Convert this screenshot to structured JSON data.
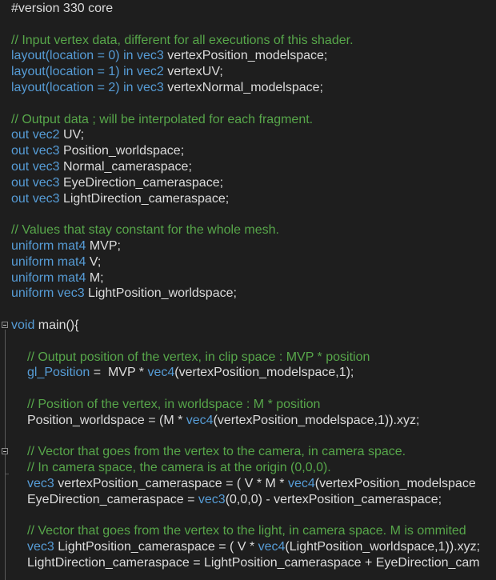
{
  "lines": [
    {
      "indent": 0,
      "segs": [
        {
          "t": "#version 330 core",
          "c": "pl"
        }
      ]
    },
    {
      "indent": 0,
      "segs": []
    },
    {
      "indent": 0,
      "segs": [
        {
          "t": "// Input vertex data, different for all executions of this shader.",
          "c": "cmt"
        }
      ]
    },
    {
      "indent": 0,
      "segs": [
        {
          "t": "layout(location = 0) in vec3 ",
          "c": "kw"
        },
        {
          "t": "vertexPosition_modelspace;",
          "c": "pl"
        }
      ]
    },
    {
      "indent": 0,
      "segs": [
        {
          "t": "layout(location = 1) in vec2 ",
          "c": "kw"
        },
        {
          "t": "vertexUV;",
          "c": "pl"
        }
      ]
    },
    {
      "indent": 0,
      "segs": [
        {
          "t": "layout(location = 2) in vec3 ",
          "c": "kw"
        },
        {
          "t": "vertexNormal_modelspace;",
          "c": "pl"
        }
      ]
    },
    {
      "indent": 0,
      "segs": []
    },
    {
      "indent": 0,
      "segs": [
        {
          "t": "// Output data ; will be interpolated for each fragment.",
          "c": "cmt"
        }
      ]
    },
    {
      "indent": 0,
      "segs": [
        {
          "t": "out vec2 ",
          "c": "kw"
        },
        {
          "t": "UV;",
          "c": "pl"
        }
      ]
    },
    {
      "indent": 0,
      "segs": [
        {
          "t": "out vec3 ",
          "c": "kw"
        },
        {
          "t": "Position_worldspace;",
          "c": "pl"
        }
      ]
    },
    {
      "indent": 0,
      "segs": [
        {
          "t": "out vec3 ",
          "c": "kw"
        },
        {
          "t": "Normal_cameraspace;",
          "c": "pl"
        }
      ]
    },
    {
      "indent": 0,
      "segs": [
        {
          "t": "out vec3 ",
          "c": "kw"
        },
        {
          "t": "EyeDirection_cameraspace;",
          "c": "pl"
        }
      ]
    },
    {
      "indent": 0,
      "segs": [
        {
          "t": "out vec3 ",
          "c": "kw"
        },
        {
          "t": "LightDirection_cameraspace;",
          "c": "pl"
        }
      ]
    },
    {
      "indent": 0,
      "segs": []
    },
    {
      "indent": 0,
      "segs": [
        {
          "t": "// Values that stay constant for the whole mesh.",
          "c": "cmt"
        }
      ]
    },
    {
      "indent": 0,
      "segs": [
        {
          "t": "uniform mat4 ",
          "c": "kw"
        },
        {
          "t": "MVP;",
          "c": "pl"
        }
      ]
    },
    {
      "indent": 0,
      "segs": [
        {
          "t": "uniform mat4 ",
          "c": "kw"
        },
        {
          "t": "V;",
          "c": "pl"
        }
      ]
    },
    {
      "indent": 0,
      "segs": [
        {
          "t": "uniform mat4 ",
          "c": "kw"
        },
        {
          "t": "M;",
          "c": "pl"
        }
      ]
    },
    {
      "indent": 0,
      "segs": [
        {
          "t": "uniform vec3 ",
          "c": "kw"
        },
        {
          "t": "LightPosition_worldspace;",
          "c": "pl"
        }
      ]
    },
    {
      "indent": 0,
      "segs": []
    },
    {
      "indent": 0,
      "fold": true,
      "segs": [
        {
          "t": "void ",
          "c": "kw"
        },
        {
          "t": "main(){",
          "c": "pl"
        }
      ]
    },
    {
      "indent": 0,
      "segs": []
    },
    {
      "indent": 1,
      "segs": [
        {
          "t": "// Output position of the vertex, in clip space : MVP * position",
          "c": "cmt"
        }
      ]
    },
    {
      "indent": 1,
      "segs": [
        {
          "t": "gl_Position",
          "c": "kw"
        },
        {
          "t": " =  MVP * ",
          "c": "pl"
        },
        {
          "t": "vec4",
          "c": "kw"
        },
        {
          "t": "(vertexPosition_modelspace,1);",
          "c": "pl"
        }
      ]
    },
    {
      "indent": 0,
      "segs": []
    },
    {
      "indent": 1,
      "segs": [
        {
          "t": "// Position of the vertex, in worldspace : M * position",
          "c": "cmt"
        }
      ]
    },
    {
      "indent": 1,
      "segs": [
        {
          "t": "Position_worldspace = (M * ",
          "c": "pl"
        },
        {
          "t": "vec4",
          "c": "kw"
        },
        {
          "t": "(vertexPosition_modelspace,1)).xyz;",
          "c": "pl"
        }
      ]
    },
    {
      "indent": 0,
      "segs": []
    },
    {
      "indent": 1,
      "fold": true,
      "segs": [
        {
          "t": "// Vector that goes from the vertex to the camera, in camera space.",
          "c": "cmt"
        }
      ]
    },
    {
      "indent": 1,
      "segs": [
        {
          "t": "// In camera space, the camera is at the origin (0,0,0).",
          "c": "cmt"
        }
      ]
    },
    {
      "indent": 1,
      "segs": [
        {
          "t": "vec3 ",
          "c": "kw"
        },
        {
          "t": "vertexPosition_cameraspace = ( V * M * ",
          "c": "pl"
        },
        {
          "t": "vec4",
          "c": "kw"
        },
        {
          "t": "(vertexPosition_modelspace",
          "c": "pl"
        }
      ]
    },
    {
      "indent": 1,
      "segs": [
        {
          "t": "EyeDirection_cameraspace = ",
          "c": "pl"
        },
        {
          "t": "vec3",
          "c": "kw"
        },
        {
          "t": "(0,0,0) - vertexPosition_cameraspace;",
          "c": "pl"
        }
      ]
    },
    {
      "indent": 0,
      "segs": []
    },
    {
      "indent": 1,
      "segs": [
        {
          "t": "// Vector that goes from the vertex to the light, in camera space. M is ommited",
          "c": "cmt"
        }
      ]
    },
    {
      "indent": 1,
      "segs": [
        {
          "t": "vec3 ",
          "c": "kw"
        },
        {
          "t": "LightPosition_cameraspace = ( V * ",
          "c": "pl"
        },
        {
          "t": "vec4",
          "c": "kw"
        },
        {
          "t": "(LightPosition_worldspace,1)).xyz;",
          "c": "pl"
        }
      ]
    },
    {
      "indent": 1,
      "segs": [
        {
          "t": "LightDirection_cameraspace = LightPosition_cameraspace + EyeDirection_cam",
          "c": "pl"
        }
      ]
    }
  ],
  "colors": {
    "background": "#1e1e1e",
    "comment": "#57a64a",
    "keyword": "#569cd6",
    "plain": "#dcdcdc"
  },
  "icons": {
    "fold": "collapse-minus-icon"
  }
}
